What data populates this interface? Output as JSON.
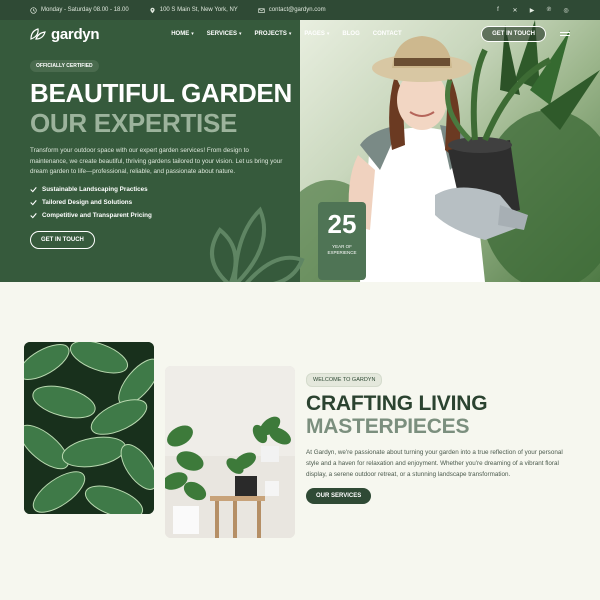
{
  "topbar": {
    "hours": "Monday - Saturday 08.00 - 18.00",
    "address": "100 S Main St, New York, NY",
    "email": "contact@gardyn.com",
    "social": [
      "facebook-icon",
      "x-icon",
      "youtube-icon",
      "pinterest-icon",
      "instagram-icon"
    ]
  },
  "nav": {
    "logo": "gardyn",
    "items": [
      "HOME",
      "SERVICES",
      "PROJECTS",
      "PAGES",
      "BLOG",
      "CONTACT"
    ],
    "cta": "GET IN TOUCH"
  },
  "hero": {
    "badge": "OFFICIALLY CERTIFIED",
    "title_line1": "BEAUTIFUL GARDEN",
    "title_line2": "OUR EXPERTISE",
    "description": "Transform your outdoor space with our expert garden services! From design to maintenance, we create beautiful, thriving gardens tailored to your vision. Let us bring your dream garden to life—professional, reliable, and passionate about nature.",
    "features": [
      "Sustainable Landscaping Practices",
      "Tailored Design and Solutions",
      "Competitive and Transparent Pricing"
    ],
    "button": "GET IN TOUCH",
    "experience_number": "25",
    "experience_label": "YEAR OF EXPERIENCE"
  },
  "about": {
    "tag": "WELCOME TO GARDYN",
    "title_line1": "CRAFTING LIVING",
    "title_line2": "MASTERPIECES",
    "description": "At Gardyn, we're passionate about turning your garden into a true reflection of your personal style and a haven for relaxation and enjoyment. Whether you're dreaming of a vibrant floral display, a serene outdoor retreat, or a stunning landscape transformation.",
    "button": "OUR SERVICES"
  },
  "colors": {
    "primary": "#365a3c",
    "dark": "#2f4a35",
    "muted_green": "#9cb39c",
    "background": "#f6f7ef"
  }
}
